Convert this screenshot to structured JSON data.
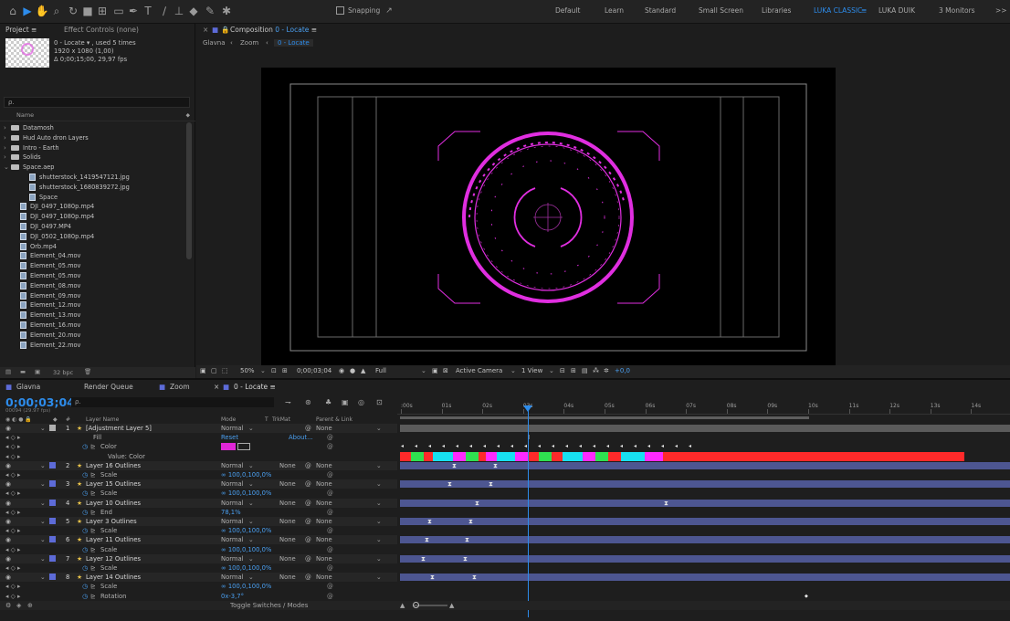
{
  "toolbar": {
    "snapping_label": "Snapping",
    "workspaces": [
      "Default",
      "Learn",
      "Standard",
      "Small Screen",
      "Libraries",
      "LUKA CLASSIC",
      "LUKA DUIK",
      "3 Monitors"
    ],
    "active_workspace_index": 5,
    "more_label": ">>"
  },
  "project": {
    "tab_label": "Project",
    "effect_controls_label": "Effect Controls (none)",
    "comp_name": "0 - Locate ▾ , used 5 times",
    "comp_size": "1920 x 1080 (1,00)",
    "comp_duration": "Δ 0;00;15;00, 29,97 fps",
    "search_placeholder": "ρ.",
    "name_header": "Name",
    "items": [
      {
        "label": "Datamosh",
        "type": "folder",
        "expanded": false,
        "indent": 0
      },
      {
        "label": "Hud Auto dron Layers",
        "type": "folder",
        "expanded": false,
        "indent": 0
      },
      {
        "label": "Intro - Earth",
        "type": "folder",
        "expanded": false,
        "indent": 0
      },
      {
        "label": "Solids",
        "type": "folder",
        "expanded": false,
        "indent": 0
      },
      {
        "label": "Space.aep",
        "type": "folder",
        "expanded": true,
        "indent": 0
      },
      {
        "label": "shutterstock_1419547121.jpg",
        "type": "file",
        "indent": 2
      },
      {
        "label": "shutterstock_1680839272.jpg",
        "type": "file",
        "indent": 2
      },
      {
        "label": "Space",
        "type": "comp",
        "indent": 2
      },
      {
        "label": "DJI_0497_1080p.mp4",
        "type": "file",
        "indent": 1
      },
      {
        "label": "DJI_0497_1080p.mp4",
        "type": "file",
        "indent": 1
      },
      {
        "label": "DJI_0497.MP4",
        "type": "file",
        "indent": 1
      },
      {
        "label": "DJI_0502_1080p.mp4",
        "type": "file",
        "indent": 1
      },
      {
        "label": "Orb.mp4",
        "type": "file",
        "indent": 1
      },
      {
        "label": "Element_04.mov",
        "type": "file",
        "indent": 1
      },
      {
        "label": "Element_05.mov",
        "type": "file",
        "indent": 1
      },
      {
        "label": "Element_05.mov",
        "type": "file",
        "indent": 1
      },
      {
        "label": "Element_08.mov",
        "type": "file",
        "indent": 1
      },
      {
        "label": "Element_09.mov",
        "type": "file",
        "indent": 1
      },
      {
        "label": "Element_12.mov",
        "type": "file",
        "indent": 1
      },
      {
        "label": "Element_13.mov",
        "type": "file",
        "indent": 1
      },
      {
        "label": "Element_16.mov",
        "type": "file",
        "indent": 1
      },
      {
        "label": "Element_20.mov",
        "type": "file",
        "indent": 1
      },
      {
        "label": "Element_22.mov",
        "type": "file",
        "indent": 1
      }
    ],
    "bpc_label": "32 bpc"
  },
  "viewer": {
    "tab_label": "Composition",
    "comp_tab_name": "0 - Locate",
    "breadcrumbs": [
      "Glavna",
      "Zoom",
      "0 - Locate"
    ],
    "zoom": "50%",
    "timecode": "0;00;03;04",
    "resolution": "Full",
    "camera": "Active Camera",
    "views": "1 View",
    "exposure": "+0,0",
    "hud_color": "#e02ee0"
  },
  "timeline": {
    "tabs": [
      "Glavna",
      "Render Queue",
      "Zoom",
      "0 - Locate"
    ],
    "active_tab_index": 3,
    "timecode": "0;00;03;04",
    "fps_label": "00094 (29.97 fps)",
    "search_placeholder": "ρ.",
    "col_headers": {
      "hash": "#",
      "layer_name": "Layer Name",
      "mode": "Mode",
      "t": "T",
      "trkmat": "TrkMat",
      "parent": "Parent & Link"
    },
    "ruler_ticks": [
      ":00s",
      "01s",
      "02s",
      "03s",
      "04s",
      "05s",
      "06s",
      "07s",
      "08s",
      "09s",
      "10s",
      "11s",
      "12s",
      "13s",
      "14s",
      "15"
    ],
    "rows": [
      {
        "kind": "layer",
        "num": "1",
        "name": "[Adjustment Layer 5]",
        "mode": "Normal",
        "trkmat": "",
        "parent": "None",
        "label_color": "#b0b0b0"
      },
      {
        "kind": "prop",
        "name": "Fill",
        "value": "Reset",
        "extra": "About...",
        "indent": 1
      },
      {
        "kind": "prop",
        "name": "Color",
        "value": "",
        "indent": 2,
        "swatch": "#e026d6"
      },
      {
        "kind": "prop",
        "name": "Value: Color",
        "value": "",
        "indent": 3
      },
      {
        "kind": "layer",
        "num": "2",
        "name": "Layer 16 Outlines",
        "mode": "Normal",
        "trkmat": "None",
        "parent": "None",
        "label_color": "#5d6bd8"
      },
      {
        "kind": "prop",
        "name": "Scale",
        "value": "∞ 100,0,100,0%",
        "indent": 2
      },
      {
        "kind": "layer",
        "num": "3",
        "name": "Layer 15 Outlines",
        "mode": "Normal",
        "trkmat": "None",
        "parent": "None",
        "label_color": "#5d6bd8"
      },
      {
        "kind": "prop",
        "name": "Scale",
        "value": "∞ 100,0,100,0%",
        "indent": 2
      },
      {
        "kind": "layer",
        "num": "4",
        "name": "Layer 10 Outlines",
        "mode": "Normal",
        "trkmat": "None",
        "parent": "None",
        "label_color": "#5d6bd8"
      },
      {
        "kind": "prop",
        "name": "End",
        "value": "78,1%",
        "indent": 2
      },
      {
        "kind": "layer",
        "num": "5",
        "name": "Layer 3 Outlines",
        "mode": "Normal",
        "trkmat": "None",
        "parent": "None",
        "label_color": "#5d6bd8"
      },
      {
        "kind": "prop",
        "name": "Scale",
        "value": "∞ 100,0,100,0%",
        "indent": 2
      },
      {
        "kind": "layer",
        "num": "6",
        "name": "Layer 11 Outlines",
        "mode": "Normal",
        "trkmat": "None",
        "parent": "None",
        "label_color": "#5d6bd8"
      },
      {
        "kind": "prop",
        "name": "Scale",
        "value": "∞ 100,0,100,0%",
        "indent": 2
      },
      {
        "kind": "layer",
        "num": "7",
        "name": "Layer 12 Outlines",
        "mode": "Normal",
        "trkmat": "None",
        "parent": "None",
        "label_color": "#5d6bd8"
      },
      {
        "kind": "prop",
        "name": "Scale",
        "value": "∞ 100,0,100,0%",
        "indent": 2
      },
      {
        "kind": "layer",
        "num": "8",
        "name": "Layer 14 Outlines",
        "mode": "Normal",
        "trkmat": "None",
        "parent": "None",
        "label_color": "#5d6bd8"
      },
      {
        "kind": "prop",
        "name": "Scale",
        "value": "∞ 100,0,100,0%",
        "indent": 2
      },
      {
        "kind": "prop",
        "name": "Rotation",
        "value": "0x-3,7°",
        "indent": 2
      }
    ],
    "toggle_label": "Toggle Switches / Modes"
  }
}
